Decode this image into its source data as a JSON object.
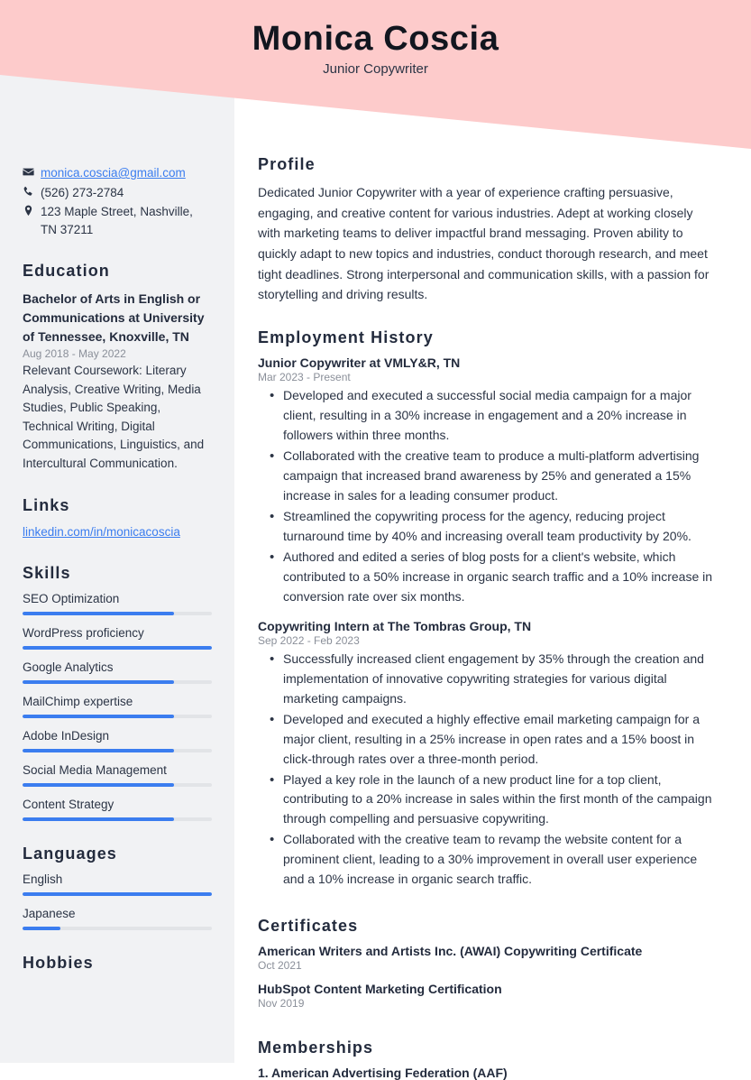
{
  "header": {
    "name": "Monica Coscia",
    "job_title": "Junior Copywriter",
    "band_color": "#FDCBCB"
  },
  "theme": {
    "accent_blue": "#3B7DEF",
    "sidebar_bg": "#F1F2F4",
    "heading_color": "#232B3D",
    "muted_text": "#8A8F99"
  },
  "sidebar": {
    "contact": {
      "email": "monica.coscia@gmail.com",
      "phone": "(526) 273-2784",
      "address": "123 Maple Street, Nashville, TN 37211",
      "icons": {
        "email": "envelope-icon",
        "phone": "phone-icon",
        "address": "map-pin-icon"
      }
    },
    "education": {
      "heading": "Education",
      "entries": [
        {
          "title": "Bachelor of Arts in English or Communications at University of Tennessee, Knoxville, TN",
          "date": "Aug 2018 - May 2022",
          "description": "Relevant Coursework: Literary Analysis, Creative Writing, Media Studies, Public Speaking, Technical Writing, Digital Communications, Linguistics, and Intercultural Communication."
        }
      ]
    },
    "links": {
      "heading": "Links",
      "items": [
        {
          "label": "linkedin.com/in/monicacoscia"
        }
      ]
    },
    "skills": {
      "heading": "Skills",
      "items": [
        {
          "label": "SEO Optimization",
          "level": 80
        },
        {
          "label": "WordPress proficiency",
          "level": 100
        },
        {
          "label": "Google Analytics",
          "level": 80
        },
        {
          "label": "MailChimp expertise",
          "level": 80
        },
        {
          "label": "Adobe InDesign",
          "level": 80
        },
        {
          "label": "Social Media Management",
          "level": 80
        },
        {
          "label": "Content Strategy",
          "level": 80
        }
      ]
    },
    "languages": {
      "heading": "Languages",
      "items": [
        {
          "label": "English",
          "level": 100
        },
        {
          "label": "Japanese",
          "level": 20
        }
      ]
    },
    "hobbies": {
      "heading": "Hobbies"
    }
  },
  "main": {
    "profile": {
      "heading": "Profile",
      "text": "Dedicated Junior Copywriter with a year of experience crafting persuasive, engaging, and creative content for various industries. Adept at working closely with marketing teams to deliver impactful brand messaging. Proven ability to quickly adapt to new topics and industries, conduct thorough research, and meet tight deadlines. Strong interpersonal and communication skills, with a passion for storytelling and driving results."
    },
    "employment": {
      "heading": "Employment History",
      "jobs": [
        {
          "title": "Junior Copywriter at VMLY&R, TN",
          "date": "Mar 2023 - Present",
          "bullets": [
            "Developed and executed a successful social media campaign for a major client, resulting in a 30% increase in engagement and a 20% increase in followers within three months.",
            "Collaborated with the creative team to produce a multi-platform advertising campaign that increased brand awareness by 25% and generated a 15% increase in sales for a leading consumer product.",
            "Streamlined the copywriting process for the agency, reducing project turnaround time by 40% and increasing overall team productivity by 20%.",
            "Authored and edited a series of blog posts for a client's website, which contributed to a 50% increase in organic search traffic and a 10% increase in conversion rate over six months."
          ]
        },
        {
          "title": "Copywriting Intern at The Tombras Group, TN",
          "date": "Sep 2022 - Feb 2023",
          "bullets": [
            "Successfully increased client engagement by 35% through the creation and implementation of innovative copywriting strategies for various digital marketing campaigns.",
            "Developed and executed a highly effective email marketing campaign for a major client, resulting in a 25% increase in open rates and a 15% boost in click-through rates over a three-month period.",
            "Played a key role in the launch of a new product line for a top client, contributing to a 20% increase in sales within the first month of the campaign through compelling and persuasive copywriting.",
            "Collaborated with the creative team to revamp the website content for a prominent client, leading to a 30% improvement in overall user experience and a 10% increase in organic search traffic."
          ]
        }
      ]
    },
    "certificates": {
      "heading": "Certificates",
      "items": [
        {
          "name": "American Writers and Artists Inc. (AWAI) Copywriting Certificate",
          "date": "Oct 2021"
        },
        {
          "name": "HubSpot Content Marketing Certification",
          "date": "Nov 2019"
        }
      ]
    },
    "memberships": {
      "heading": "Memberships",
      "items": [
        {
          "text": "1. American Advertising Federation (AAF)"
        }
      ]
    }
  }
}
